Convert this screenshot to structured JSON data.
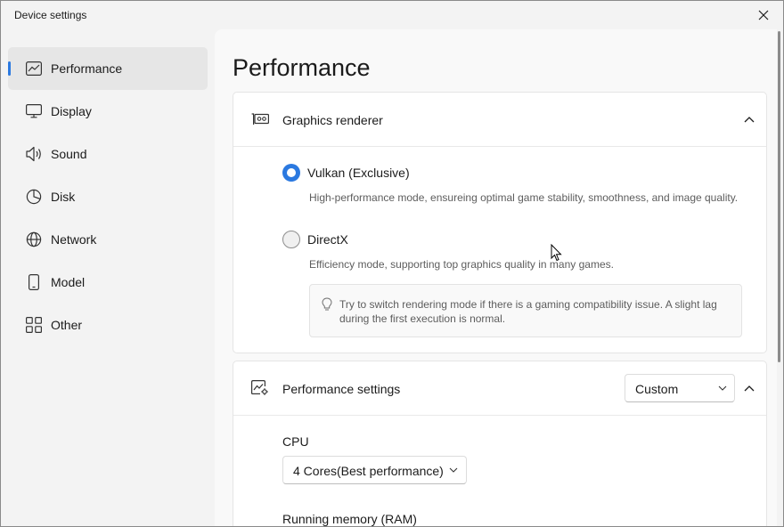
{
  "window": {
    "title": "Device settings"
  },
  "sidebar": {
    "items": [
      {
        "label": "Performance",
        "icon": "performance-chart-icon",
        "active": true
      },
      {
        "label": "Display",
        "icon": "monitor-icon"
      },
      {
        "label": "Sound",
        "icon": "speaker-icon"
      },
      {
        "label": "Disk",
        "icon": "pie-disk-icon"
      },
      {
        "label": "Network",
        "icon": "globe-icon"
      },
      {
        "label": "Model",
        "icon": "phone-icon"
      },
      {
        "label": "Other",
        "icon": "grid-icon"
      }
    ]
  },
  "main": {
    "title": "Performance",
    "graphics": {
      "title": "Graphics renderer",
      "icon": "graphics-card-icon",
      "options": [
        {
          "label": "Vulkan (Exclusive)",
          "description": "High-performance mode, ensureing optimal game stability, smoothness, and image quality.",
          "selected": true
        },
        {
          "label": "DirectX",
          "description": "Efficiency mode, supporting top graphics quality in many games.",
          "selected": false
        }
      ],
      "tip": "Try to switch rendering mode if there is a gaming compatibility issue. A slight lag during the first execution is normal.",
      "tip_icon": "lightbulb-icon"
    },
    "performance_settings": {
      "title": "Performance settings",
      "icon": "performance-gear-icon",
      "mode": "Custom",
      "cpu_label": "CPU",
      "cpu_value": "4 Cores(Best performance)",
      "ram_label": "Running memory (RAM)"
    }
  },
  "colors": {
    "accent": "#2b79e0",
    "window_bg": "#f3f3f3",
    "card_bg": "#ffffff"
  }
}
